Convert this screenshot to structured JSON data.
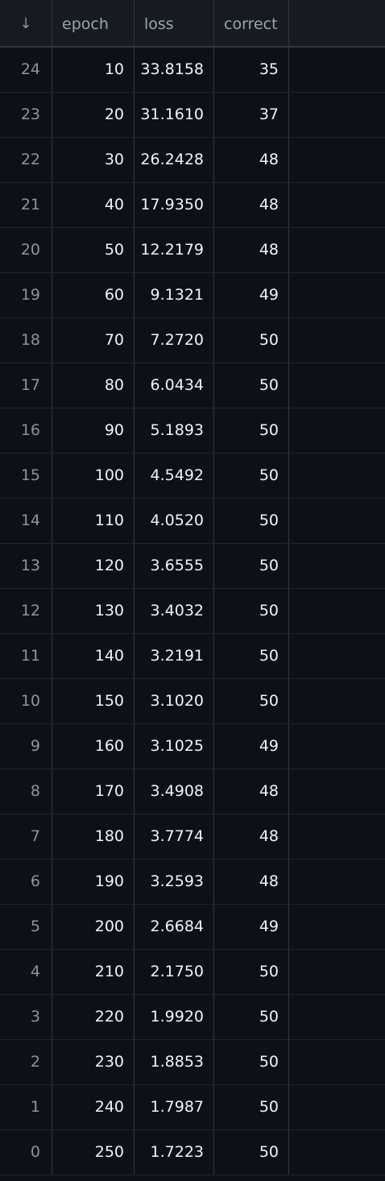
{
  "table": {
    "sort_icon": "↓",
    "columns": [
      "epoch",
      "loss",
      "correct"
    ],
    "rows": [
      {
        "index": "24",
        "epoch": "10",
        "loss": "33.8158",
        "correct": "35"
      },
      {
        "index": "23",
        "epoch": "20",
        "loss": "31.1610",
        "correct": "37"
      },
      {
        "index": "22",
        "epoch": "30",
        "loss": "26.2428",
        "correct": "48"
      },
      {
        "index": "21",
        "epoch": "40",
        "loss": "17.9350",
        "correct": "48"
      },
      {
        "index": "20",
        "epoch": "50",
        "loss": "12.2179",
        "correct": "48"
      },
      {
        "index": "19",
        "epoch": "60",
        "loss": "9.1321",
        "correct": "49"
      },
      {
        "index": "18",
        "epoch": "70",
        "loss": "7.2720",
        "correct": "50"
      },
      {
        "index": "17",
        "epoch": "80",
        "loss": "6.0434",
        "correct": "50"
      },
      {
        "index": "16",
        "epoch": "90",
        "loss": "5.1893",
        "correct": "50"
      },
      {
        "index": "15",
        "epoch": "100",
        "loss": "4.5492",
        "correct": "50"
      },
      {
        "index": "14",
        "epoch": "110",
        "loss": "4.0520",
        "correct": "50"
      },
      {
        "index": "13",
        "epoch": "120",
        "loss": "3.6555",
        "correct": "50"
      },
      {
        "index": "12",
        "epoch": "130",
        "loss": "3.4032",
        "correct": "50"
      },
      {
        "index": "11",
        "epoch": "140",
        "loss": "3.2191",
        "correct": "50"
      },
      {
        "index": "10",
        "epoch": "150",
        "loss": "3.1020",
        "correct": "50"
      },
      {
        "index": "9",
        "epoch": "160",
        "loss": "3.1025",
        "correct": "49"
      },
      {
        "index": "8",
        "epoch": "170",
        "loss": "3.4908",
        "correct": "48"
      },
      {
        "index": "7",
        "epoch": "180",
        "loss": "3.7774",
        "correct": "48"
      },
      {
        "index": "6",
        "epoch": "190",
        "loss": "3.2593",
        "correct": "48"
      },
      {
        "index": "5",
        "epoch": "200",
        "loss": "2.6684",
        "correct": "49"
      },
      {
        "index": "4",
        "epoch": "210",
        "loss": "2.1750",
        "correct": "50"
      },
      {
        "index": "3",
        "epoch": "220",
        "loss": "1.9920",
        "correct": "50"
      },
      {
        "index": "2",
        "epoch": "230",
        "loss": "1.8853",
        "correct": "50"
      },
      {
        "index": "1",
        "epoch": "240",
        "loss": "1.7987",
        "correct": "50"
      },
      {
        "index": "0",
        "epoch": "250",
        "loss": "1.7223",
        "correct": "50"
      }
    ]
  },
  "colors": {
    "background": "#0d1117",
    "header_background": "#161b22",
    "border": "#30363d",
    "text": "#f0f3f6",
    "muted_text": "#8b949e"
  }
}
